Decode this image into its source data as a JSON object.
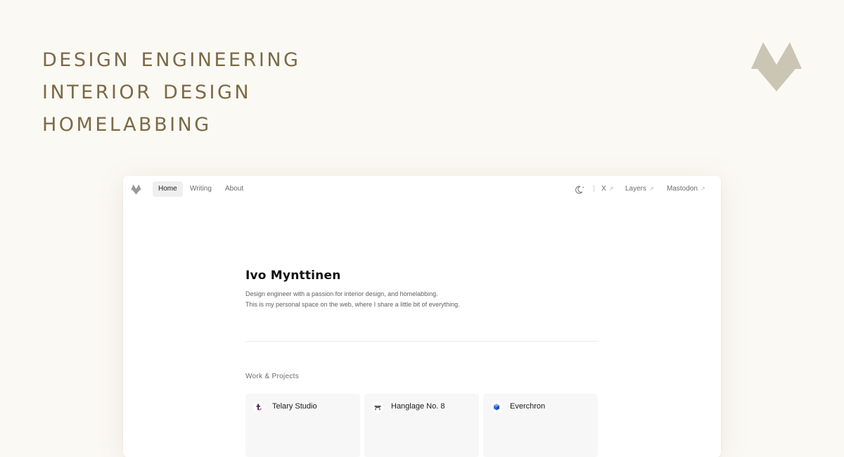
{
  "hero": {
    "taglines": [
      "Design Engineering",
      "Interior Design",
      "Homelabbing"
    ],
    "logo_icon": "monogram-m-icon"
  },
  "nav": {
    "logo_icon": "monogram-m-icon",
    "tabs": [
      {
        "label": "Home",
        "active": true
      },
      {
        "label": "Writing",
        "active": false
      },
      {
        "label": "About",
        "active": false
      }
    ],
    "theme_toggle_icon": "moon-icon",
    "separator": "|",
    "links": [
      {
        "label": "X",
        "icon": "arrow-up-right-icon"
      },
      {
        "label": "Layers",
        "icon": "arrow-up-right-icon"
      },
      {
        "label": "Mastodon",
        "icon": "arrow-up-right-icon"
      }
    ]
  },
  "profile": {
    "name": "Ivo Mynttinen",
    "bio": [
      "Design engineer with a passion for interior design, and homelabbing.",
      "This is my personal space on the web, where I share a little bit of everything."
    ]
  },
  "projects": {
    "heading": "Work & Projects",
    "items": [
      {
        "title": "Telary Studio",
        "icon": "telary-logo-icon"
      },
      {
        "title": "Hanglage No. 8",
        "icon": "hanglage-logo-icon"
      },
      {
        "title": "Everchron",
        "icon": "everchron-logo-icon"
      }
    ]
  },
  "colors": {
    "page_background": "#fbf9f4",
    "tagline": "#7a6a46",
    "brand_mark": "#cbc6b4",
    "window_background": "#ffffff",
    "card_background": "#f7f7f7"
  }
}
